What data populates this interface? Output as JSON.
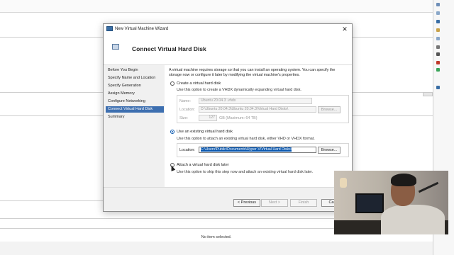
{
  "window": {
    "title": "New Virtual Machine Wizard"
  },
  "header": {
    "title": "Connect Virtual Hard Disk"
  },
  "nav": {
    "items": [
      {
        "label": "Before You Begin",
        "active": false
      },
      {
        "label": "Specify Name and Location",
        "active": false
      },
      {
        "label": "Specify Generation",
        "active": false
      },
      {
        "label": "Assign Memory",
        "active": false
      },
      {
        "label": "Configure Networking",
        "active": false
      },
      {
        "label": "Connect Virtual Hard Disk",
        "active": true
      },
      {
        "label": "Summary",
        "active": false
      }
    ]
  },
  "content": {
    "description": "A virtual machine requires storage so that you can install an operating system. You can specify the storage now or configure it later by modifying the virtual machine's properties.",
    "create": {
      "label": "Create a virtual hard disk",
      "help": "Use this option to create a VHDX dynamically expanding virtual hard disk.",
      "name_label": "Name:",
      "name_value": "Ubuntu 20.04.3 .vhdx",
      "location_label": "Location:",
      "location_value": "D:\\Ubuntu 20.04.3\\Ubuntu 20.04.3\\Virtual Hard Disks\\",
      "browse_label": "Browse...",
      "size_label": "Size:",
      "size_value": "127",
      "size_unit": "GB (Maximum: 64 TB)"
    },
    "existing": {
      "label": "Use an existing virtual hard disk",
      "help": "Use this option to attach an existing virtual hard disk, either VHD or VHDX format.",
      "location_label": "Location:",
      "location_value": "C:\\Users\\Public\\Documents\\Hyper-V\\Virtual Hard Disks\\",
      "browse_label": "Browse..."
    },
    "later": {
      "label": "Attach a virtual hard disk later",
      "help": "Use this option to skip this step now and attach an existing virtual hard disk later."
    }
  },
  "footer": {
    "previous": "< Previous",
    "next": "Next >",
    "finish": "Finish",
    "cancel": "Cancel"
  },
  "status_bar": {
    "text": "No item selected."
  }
}
